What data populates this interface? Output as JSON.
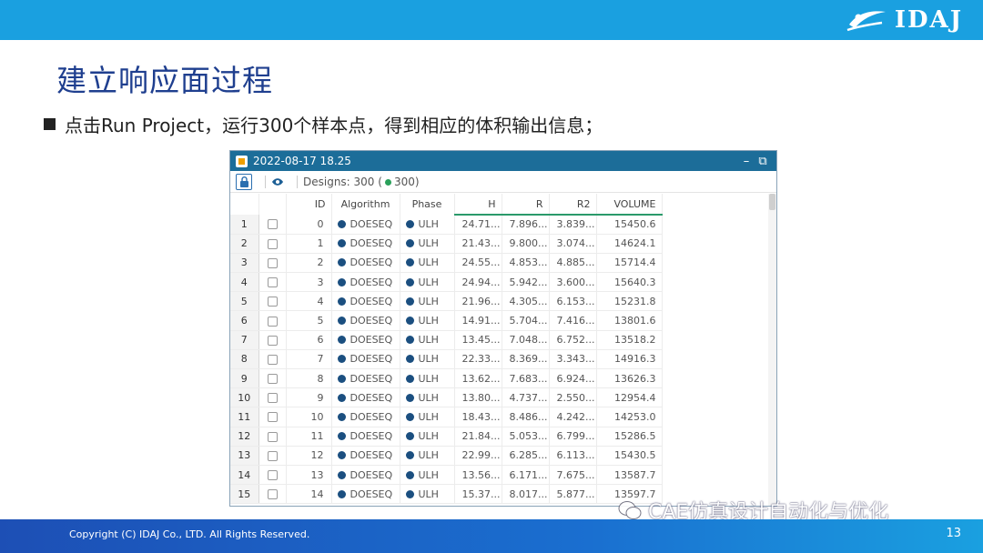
{
  "header": {
    "brand": "IDAJ"
  },
  "slide": {
    "title": "建立响应面过程",
    "bullet": "点击Run Project，运行300个样本点，得到相应的体积输出信息；"
  },
  "window": {
    "title": "2022-08-17 18.25",
    "minimize": "–",
    "restore": "⧉",
    "designs_prefix": "Designs: 300 (",
    "designs_count": "300)"
  },
  "table": {
    "columns": {
      "id": "ID",
      "algorithm": "Algorithm",
      "phase": "Phase",
      "h": "H",
      "r": "R",
      "r2": "R2",
      "volume": "VOLUME"
    },
    "rows": [
      {
        "n": "1",
        "id": "0",
        "algorithm": "DOESEQ",
        "phase": "ULH",
        "h": "24.71...",
        "r": "7.896...",
        "r2": "3.839...",
        "volume": "15450.6"
      },
      {
        "n": "2",
        "id": "1",
        "algorithm": "DOESEQ",
        "phase": "ULH",
        "h": "21.43...",
        "r": "9.800...",
        "r2": "3.074...",
        "volume": "14624.1"
      },
      {
        "n": "3",
        "id": "2",
        "algorithm": "DOESEQ",
        "phase": "ULH",
        "h": "24.55...",
        "r": "4.853...",
        "r2": "4.885...",
        "volume": "15714.4"
      },
      {
        "n": "4",
        "id": "3",
        "algorithm": "DOESEQ",
        "phase": "ULH",
        "h": "24.94...",
        "r": "5.942...",
        "r2": "3.600...",
        "volume": "15640.3"
      },
      {
        "n": "5",
        "id": "4",
        "algorithm": "DOESEQ",
        "phase": "ULH",
        "h": "21.96...",
        "r": "4.305...",
        "r2": "6.153...",
        "volume": "15231.8"
      },
      {
        "n": "6",
        "id": "5",
        "algorithm": "DOESEQ",
        "phase": "ULH",
        "h": "14.91...",
        "r": "5.704...",
        "r2": "7.416...",
        "volume": "13801.6"
      },
      {
        "n": "7",
        "id": "6",
        "algorithm": "DOESEQ",
        "phase": "ULH",
        "h": "13.45...",
        "r": "7.048...",
        "r2": "6.752...",
        "volume": "13518.2"
      },
      {
        "n": "8",
        "id": "7",
        "algorithm": "DOESEQ",
        "phase": "ULH",
        "h": "22.33...",
        "r": "8.369...",
        "r2": "3.343...",
        "volume": "14916.3"
      },
      {
        "n": "9",
        "id": "8",
        "algorithm": "DOESEQ",
        "phase": "ULH",
        "h": "13.62...",
        "r": "7.683...",
        "r2": "6.924...",
        "volume": "13626.3"
      },
      {
        "n": "10",
        "id": "9",
        "algorithm": "DOESEQ",
        "phase": "ULH",
        "h": "13.80...",
        "r": "4.737...",
        "r2": "2.550...",
        "volume": "12954.4"
      },
      {
        "n": "11",
        "id": "10",
        "algorithm": "DOESEQ",
        "phase": "ULH",
        "h": "18.43...",
        "r": "8.486...",
        "r2": "4.242...",
        "volume": "14253.0"
      },
      {
        "n": "12",
        "id": "11",
        "algorithm": "DOESEQ",
        "phase": "ULH",
        "h": "21.84...",
        "r": "5.053...",
        "r2": "6.799...",
        "volume": "15286.5"
      },
      {
        "n": "13",
        "id": "12",
        "algorithm": "DOESEQ",
        "phase": "ULH",
        "h": "22.99...",
        "r": "6.285...",
        "r2": "6.113...",
        "volume": "15430.5"
      },
      {
        "n": "14",
        "id": "13",
        "algorithm": "DOESEQ",
        "phase": "ULH",
        "h": "13.56...",
        "r": "6.171...",
        "r2": "7.675...",
        "volume": "13587.7"
      },
      {
        "n": "15",
        "id": "14",
        "algorithm": "DOESEQ",
        "phase": "ULH",
        "h": "15.37...",
        "r": "8.017...",
        "r2": "5.877...",
        "volume": "13597.7"
      }
    ]
  },
  "footer": {
    "copyright": "Copyright (C) IDAJ Co., LTD. All Rights Reserved.",
    "page": "13"
  },
  "watermark": {
    "text": "CAE仿真设计自动化与优化"
  },
  "colors": {
    "accent": "#1aa0e0",
    "title": "#1f3f8f",
    "window_bar": "#1c6d99",
    "dot": "#1b4f80",
    "status_green": "#2aa05a"
  }
}
